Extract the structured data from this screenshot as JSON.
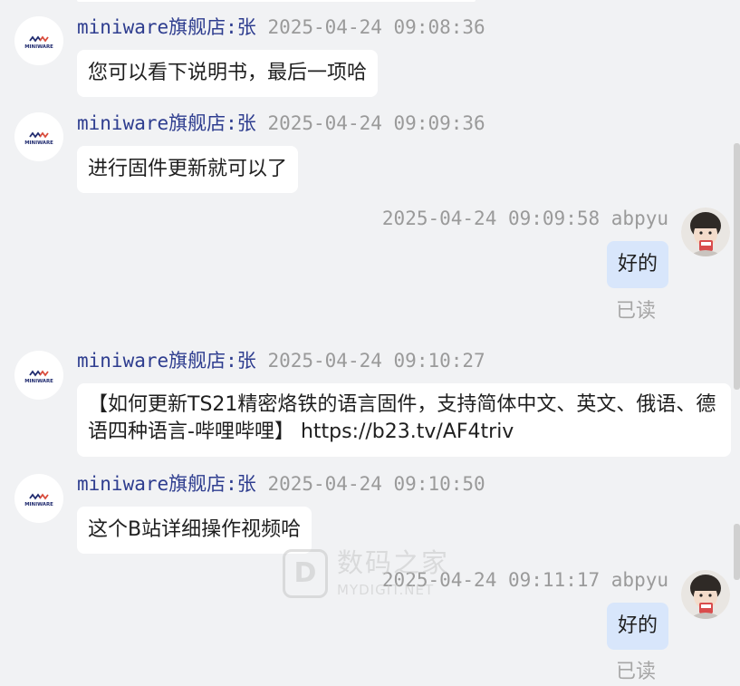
{
  "messages": [
    {
      "sender": "miniware旗舰店:张",
      "time": "2025-04-24 09:08:36",
      "text": "您可以看下说明书，最后一项哈"
    },
    {
      "sender": "miniware旗舰店:张",
      "time": "2025-04-24 09:09:36",
      "text": "进行固件更新就可以了"
    },
    {
      "user": "abpyu",
      "time": "2025-04-24 09:09:58",
      "text": "好的",
      "status": "已读"
    },
    {
      "sender": "miniware旗舰店:张",
      "time": "2025-04-24 09:10:27",
      "text": "【如何更新TS21精密烙铁的语言固件，支持简体中文、英文、俄语、德语四种语言-哔哩哔哩】",
      "link": "https://b23.tv/AF4triv"
    },
    {
      "sender": "miniware旗舰店:张",
      "time": "2025-04-24 09:10:50",
      "text": "这个B站详细操作视频哈"
    },
    {
      "user": "abpyu",
      "time": "2025-04-24 09:11:17",
      "text": "好的",
      "status": "已读"
    }
  ],
  "watermark": {
    "cn": "数码之家",
    "en": "MYDIGIT.NET",
    "mark": "D"
  },
  "logo_text": "MINIWARE",
  "colors": {
    "background": "#f1f2f4",
    "incoming_bubble": "#ffffff",
    "outgoing_bubble": "#d8e6fb",
    "sender_name": "#2e3d8f",
    "timestamp": "#9a9a9a"
  },
  "icons": {
    "shop_avatar": "miniware-logo-icon",
    "user_avatar": "user-photo-avatar"
  }
}
